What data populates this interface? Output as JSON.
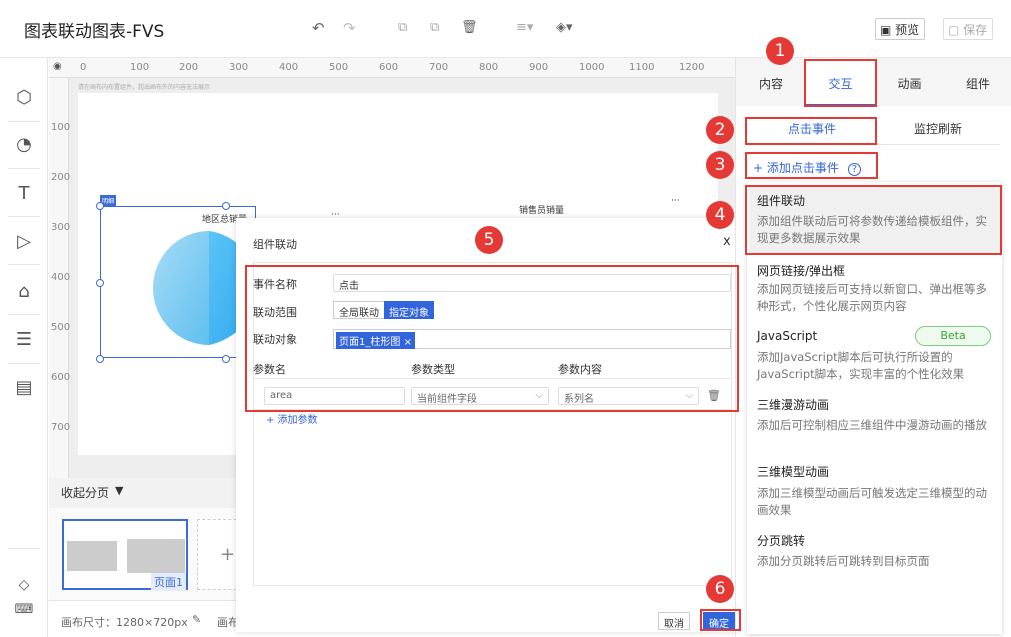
{
  "app": {
    "title": "图表联动图表-FVS"
  },
  "toolbar": {
    "preview_label": "预览",
    "save_label": "保存"
  },
  "ruler": {
    "ticks": [
      "0",
      "100",
      "200",
      "300",
      "400",
      "500",
      "600",
      "700",
      "800",
      "900",
      "1000",
      "1100",
      "1200"
    ],
    "vticks": [
      "100",
      "200",
      "300",
      "400",
      "500",
      "600",
      "700"
    ]
  },
  "canvas": {
    "hint": "请在画布内布置组件，超出画布外的内容无法展示",
    "chart1_title": "地区总销量",
    "chart2_title": "销售员销量",
    "chart_tag": "明细",
    "more": "···"
  },
  "pages": {
    "collapse_label": "收起分页",
    "page1_label": "页面1",
    "add": "+"
  },
  "footer": {
    "canvas_size": "画布尺寸：1280×720px",
    "extra": "画布"
  },
  "dialog": {
    "title": "组件联动",
    "close": "x",
    "event_name_label": "事件名称",
    "event_name_value": "点击",
    "scope_label": "联动范围",
    "scope_options": [
      "全局联动",
      "指定对象"
    ],
    "target_label": "联动对象",
    "target_tag": "页面1_柱形图",
    "param_headers": [
      "参数名",
      "参数类型",
      "参数内容"
    ],
    "param_name": "area",
    "param_type": "当前组件字段",
    "param_content": "系列名",
    "add_param": "+ 添加参数",
    "cancel": "取消",
    "confirm": "确定"
  },
  "right_panel": {
    "tabs": [
      "内容",
      "交互",
      "动画",
      "组件"
    ],
    "sub_tabs": [
      "点击事件",
      "监控刷新"
    ],
    "add_event": "+ 添加点击事件",
    "items": [
      {
        "title": "组件联动",
        "desc": "添加组件联动后可将参数传递给模板组件，实现更多数据展示效果"
      },
      {
        "title": "网页链接/弹出框",
        "desc": "添加网页链接后可支持以新窗口、弹出框等多种形式，个性化展示网页内容"
      },
      {
        "title": "JavaScript",
        "desc": "添加JavaScript脚本后可执行所设置的JavaScript脚本，实现丰富的个性化效果",
        "badge": "Beta"
      },
      {
        "title": "三维漫游动画",
        "desc": "添加后可控制相应三维组件中漫游动画的播放"
      },
      {
        "title": "三维模型动画",
        "desc": "添加三维模型动画后可触发选定三维模型的动画效果"
      },
      {
        "title": "分页跳转",
        "desc": "添加分页跳转后可跳转到目标页面"
      }
    ]
  },
  "badges": [
    "1",
    "2",
    "3",
    "4",
    "5",
    "6"
  ],
  "colors": {
    "accent": "#3264dc",
    "red": "#e53935"
  }
}
